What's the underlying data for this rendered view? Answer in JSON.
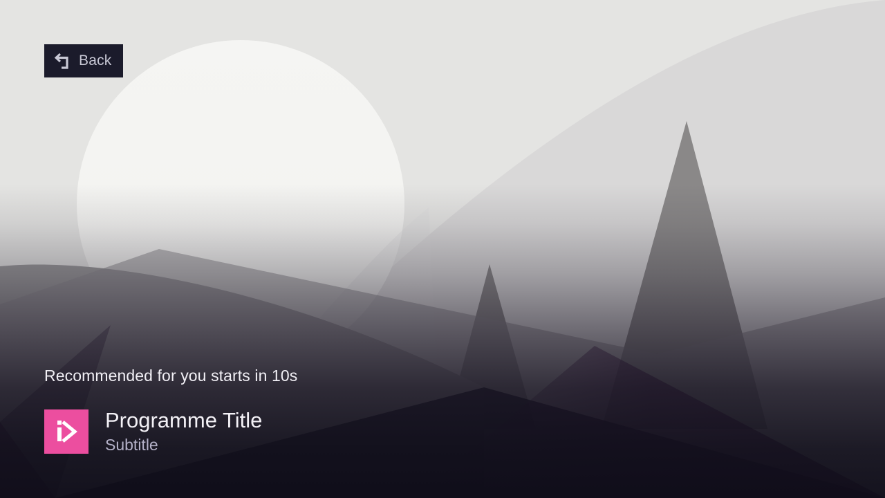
{
  "back_button": {
    "label": "Back",
    "icon": "back-arrow-icon"
  },
  "autoplay": {
    "countdown_text": "Recommended for you starts in 10s"
  },
  "programme": {
    "title": "Programme Title",
    "subtitle": "Subtitle",
    "logo_icon": "play-logo-icon"
  },
  "colors": {
    "accent": "#ec4e9f",
    "button_bg": "#1b1b2b",
    "title_text": "#f3f1f6",
    "subtitle_text": "#b5b2c9"
  }
}
